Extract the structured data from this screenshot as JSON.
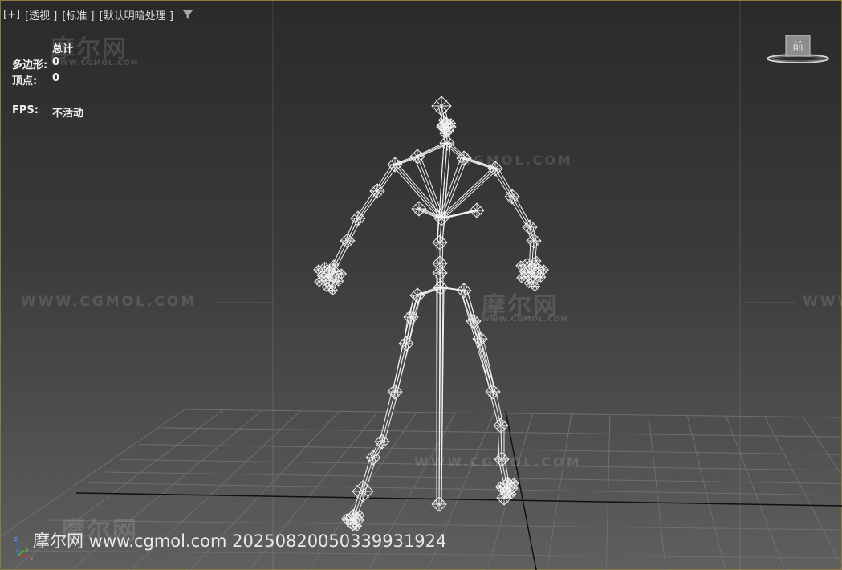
{
  "toolbar": {
    "plus": "[+]",
    "view": "[透视 ]",
    "shading": "[标准 ]",
    "lighting": "[默认明暗处理 ]"
  },
  "stats": {
    "header": "总计",
    "polygons_label": "多边形:",
    "polygons_value": "0",
    "vertices_label": "顶点:",
    "vertices_value": "0",
    "fps_label": "FPS:",
    "fps_value": "不活动"
  },
  "watermarks": {
    "cn": "摩尔网",
    "url_upper": "WWW.CGMOL.COM",
    "url_upper_partial": "CGMOL.COM",
    "url_partial_right": "WWW"
  },
  "viewcube": {
    "face": "前"
  },
  "axis": {
    "x": "x",
    "y": "y",
    "z": "z"
  },
  "bottom_watermark": "摩尔网 www.cgmol.com 20250820050339931924"
}
